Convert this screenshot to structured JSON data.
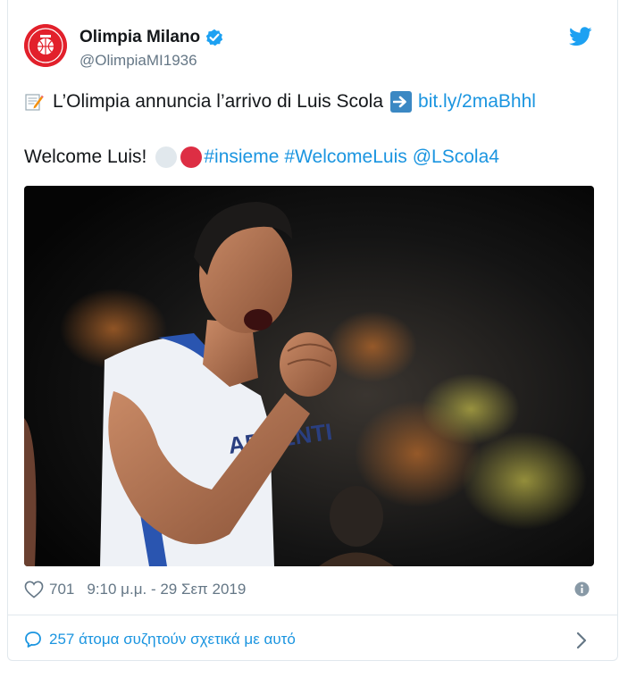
{
  "tweet": {
    "author_name": "Olimpia Milano",
    "author_handle": "@OlimpiaMI1936",
    "text_line1": "L’Olimpia annuncia l’arrivo di Luis Scola",
    "link": "bit.ly/2maBhhl",
    "text_line2": "Welcome Luis!",
    "hashtags": [
      "#insieme",
      "#WelcomeLuis"
    ],
    "mention": "@LScola4",
    "likes": "701",
    "timestamp": "9:10 μ.μ. - 29 Σεπ 2019",
    "conversation": "257 άτομα συζητούν σχετικά με αυτό"
  },
  "icons": {
    "avatar": "olimpia-milano-logo",
    "verified": "verified-badge-icon",
    "twitter": "twitter-bird-icon",
    "memo": "memo-emoji-icon",
    "arrow": "right-arrow-emoji-icon",
    "heart": "heart-icon",
    "info": "info-icon",
    "bubble": "speech-bubble-icon",
    "chevron": "chevron-right-icon"
  },
  "colors": {
    "link_blue": "#1b95e0",
    "verified_blue": "#1da1f2",
    "emoji_red": "#dd2e44",
    "logo_red": "#e2202b",
    "muted_gray": "#657786"
  }
}
